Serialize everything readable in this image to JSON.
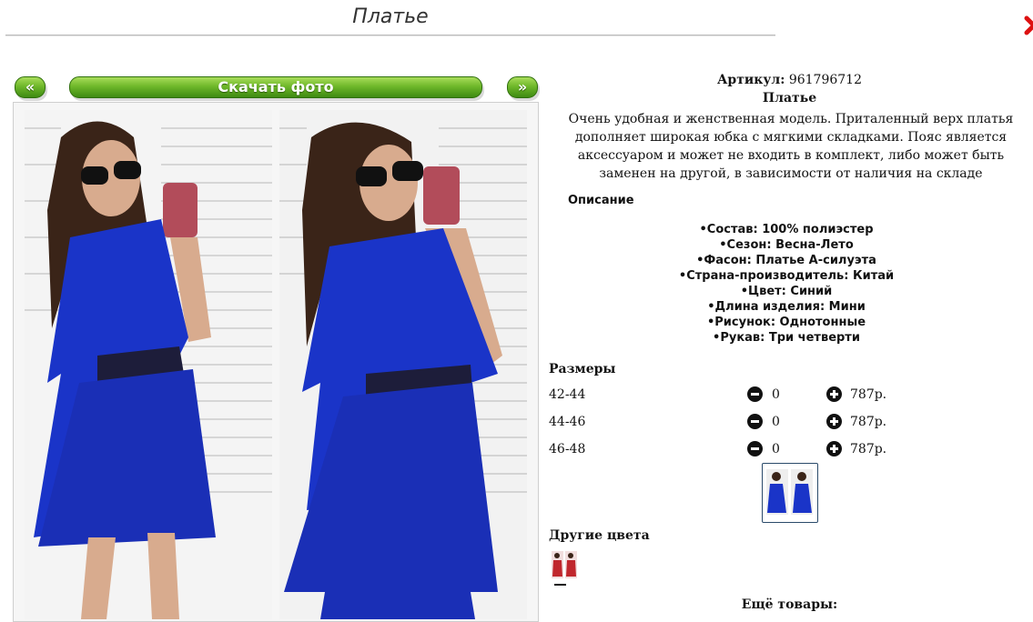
{
  "header": {
    "title": "Платье"
  },
  "gallery": {
    "prev_label": "«",
    "download_label": "Скачать фото",
    "next_label": "»",
    "accent_color": "#5ea820"
  },
  "product": {
    "sku_label": "Артикул:",
    "sku_value": "961796712",
    "name": "Платье",
    "description": "Очень удобная и женственная модель. Приталенный верх платья дополняет широкая юбка с мягкими складками. Пояс является аксессуаром и может не входить в комплект, либо может быть заменен на другой, в зависимости от наличия на складе",
    "description_heading": "Описание",
    "attributes": [
      "Состав: 100% полиэстер",
      "Сезон: Весна-Лето",
      "Фасон: Платье А-силуэта",
      "Страна-производитель: Китай",
      "Цвет: Синий",
      "Длина изделия: Мини",
      "Рисунок: Однотонные",
      "Рукав: Три четверти"
    ]
  },
  "sizes": {
    "heading": "Размеры",
    "rows": [
      {
        "size": "42-44",
        "qty": "0",
        "price": "787р."
      },
      {
        "size": "44-46",
        "qty": "0",
        "price": "787р."
      },
      {
        "size": "46-48",
        "qty": "0",
        "price": "787р."
      }
    ]
  },
  "other_colors": {
    "heading": "Другие цвета",
    "swatch_color": "#c0272d"
  },
  "more_products": {
    "dash": "—",
    "heading": "Ещё товары:"
  },
  "icons": {
    "close": "close-icon",
    "minus": "minus-circle-icon",
    "plus": "plus-circle-icon"
  }
}
